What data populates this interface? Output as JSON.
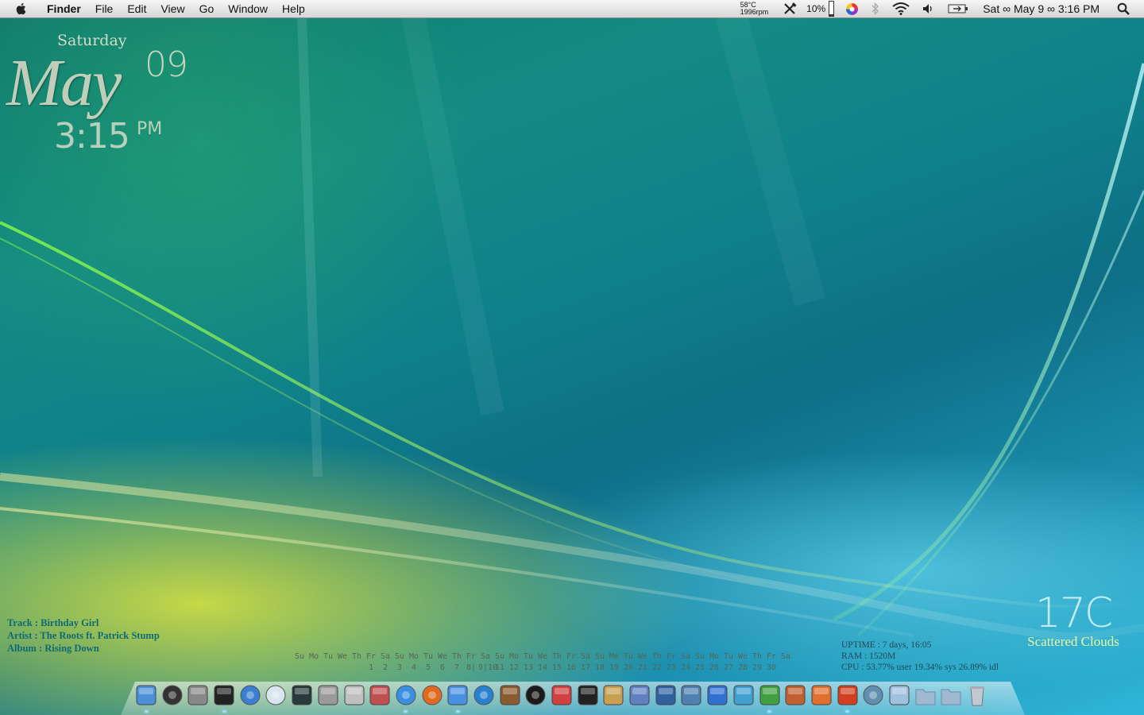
{
  "menubar": {
    "app_name": "Finder",
    "menus": [
      "File",
      "Edit",
      "View",
      "Go",
      "Window",
      "Help"
    ],
    "temperature": "58°C",
    "fan_speed": "1996rpm",
    "cpu_percent": "10%",
    "clock": "Sat ∞ May 9 ∞ 3:16 PM"
  },
  "date_widget": {
    "day": "Saturday",
    "month": "May",
    "date": "09",
    "time": "3:15",
    "ampm": "PM"
  },
  "track_widget": {
    "track": "Track : Birthday Girl",
    "artist": "Artist : The Roots ft. Patrick Stump",
    "album": "Album : Rising Down"
  },
  "calendar": {
    "weekdays": [
      "Su",
      "Mo",
      "Tu",
      "We",
      "Th",
      "Fr",
      "Sa",
      "Su",
      "Mo",
      "Tu",
      "We",
      "Th",
      "Fr",
      "Sa",
      "Su",
      "Mo",
      "Tu",
      "We",
      "Th",
      "Fr",
      "Sa",
      "Su",
      "Mo",
      "Tu",
      "We",
      "Th",
      "Fr",
      "Sa",
      "Su",
      "Mo",
      "Tu",
      "We",
      "Th",
      "Fr",
      "Sa"
    ],
    "days": [
      "",
      "",
      "",
      "",
      "",
      "1",
      "2",
      "3",
      "4",
      "5",
      "6",
      "7",
      "8|",
      "9|10",
      "11",
      "12",
      "13",
      "14",
      "15",
      "16",
      "17",
      "18",
      "19",
      "20",
      "21",
      "22",
      "23",
      "24",
      "25",
      "26",
      "27",
      "28",
      "29",
      "30",
      ""
    ]
  },
  "system": {
    "uptime": "UPTIME : 7 days, 16:05",
    "ram": "RAM : 1520M",
    "cpu": "CPU : 53.77% user  19.34% sys  26.89% idl"
  },
  "weather": {
    "temperature": "17C",
    "condition": "Scattered Clouds"
  },
  "dock": {
    "apps": [
      {
        "name": "finder-icon",
        "color": "#4a8fd8"
      },
      {
        "name": "dashboard-icon",
        "color": "#333333"
      },
      {
        "name": "system-preferences-icon",
        "color": "#888888"
      },
      {
        "name": "terminal-icon",
        "color": "#222222"
      },
      {
        "name": "airport-utility-icon",
        "color": "#3a7fd0"
      },
      {
        "name": "wifi-icon",
        "color": "#d8e6f0"
      },
      {
        "name": "activity-monitor-icon",
        "color": "#2a3a3a"
      },
      {
        "name": "disk-utility-icon",
        "color": "#9a9a9a"
      },
      {
        "name": "script-editor-icon",
        "color": "#c0c0c0"
      },
      {
        "name": "photo-booth-icon",
        "color": "#c05050"
      },
      {
        "name": "safari-icon",
        "color": "#3a8fe0"
      },
      {
        "name": "firefox-icon",
        "color": "#e06a20"
      },
      {
        "name": "itunes-icon",
        "color": "#4a90e0"
      },
      {
        "name": "quicktime-icon",
        "color": "#2a80d0"
      },
      {
        "name": "iphoto-icon",
        "color": "#8a5a30"
      },
      {
        "name": "camera-icon",
        "color": "#1a1a1a"
      },
      {
        "name": "adium-icon",
        "color": "#d04040"
      },
      {
        "name": "black-box-icon",
        "color": "#222222"
      },
      {
        "name": "xcode-icon",
        "color": "#c8a050"
      },
      {
        "name": "vmware-icon",
        "color": "#6080c0"
      },
      {
        "name": "spaces-icon",
        "color": "#3060a0"
      },
      {
        "name": "stylus-icon",
        "color": "#5080b0"
      },
      {
        "name": "word-icon",
        "color": "#3070d0"
      },
      {
        "name": "charts-icon",
        "color": "#40a0d0"
      },
      {
        "name": "excel-icon",
        "color": "#40a040"
      },
      {
        "name": "keynote-icon",
        "color": "#c06030"
      },
      {
        "name": "powerpoint-icon",
        "color": "#e07030"
      },
      {
        "name": "transmission-icon",
        "color": "#d04020"
      },
      {
        "name": "network-icon",
        "color": "#6090b0"
      },
      {
        "name": "downloads-stack-icon",
        "color": "#a0c0e0"
      },
      {
        "name": "applications-folder-icon",
        "color": "#a0b8d0"
      },
      {
        "name": "documents-folder-icon",
        "color": "#a0b8d0"
      },
      {
        "name": "trash-icon",
        "color": "#c0c8d0"
      }
    ]
  }
}
